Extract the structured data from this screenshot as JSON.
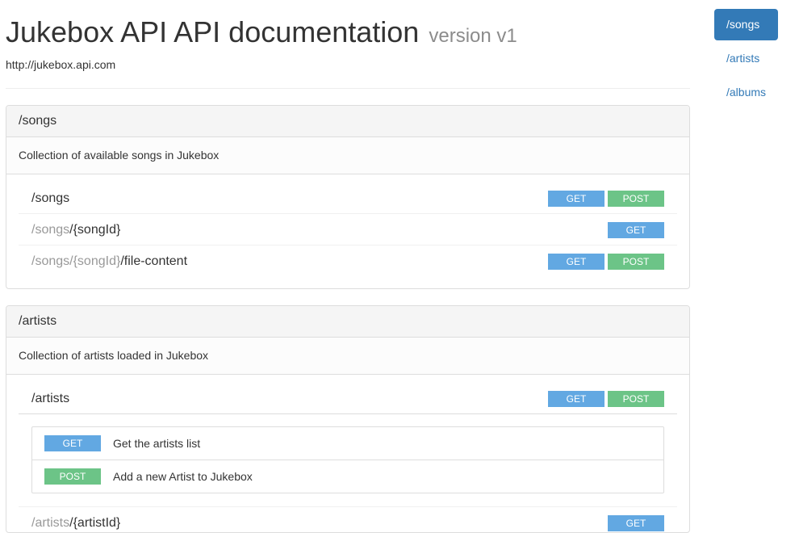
{
  "header": {
    "title": "Jukebox API API documentation",
    "version": "version v1",
    "base_url": "http://jukebox.api.com"
  },
  "sidebar": {
    "items": [
      {
        "label": "/songs",
        "active": true
      },
      {
        "label": "/artists",
        "active": false
      },
      {
        "label": "/albums",
        "active": false
      }
    ]
  },
  "sections": {
    "songs": {
      "title": "/songs",
      "description": "Collection of available songs in Jukebox",
      "resources": [
        {
          "parent": "",
          "path": "/songs",
          "methods": [
            "GET",
            "POST"
          ]
        },
        {
          "parent": "/songs",
          "path": "/{songId}",
          "methods": [
            "GET"
          ]
        },
        {
          "parent": "/songs/{songId}",
          "path": "/file-content",
          "methods": [
            "GET",
            "POST"
          ]
        }
      ]
    },
    "artists": {
      "title": "/artists",
      "description": "Collection of artists loaded in Jukebox",
      "resources": [
        {
          "parent": "",
          "path": "/artists",
          "methods": [
            "GET",
            "POST"
          ],
          "method_details": [
            {
              "method": "GET",
              "description": "Get the artists list"
            },
            {
              "method": "POST",
              "description": "Add a new Artist to Jukebox"
            }
          ]
        },
        {
          "parent": "/artists",
          "path": "/{artistId}",
          "methods": [
            "GET"
          ]
        }
      ]
    }
  },
  "colors": {
    "get": "#62a8e2",
    "post": "#6cc487",
    "accent": "#337ab7"
  }
}
